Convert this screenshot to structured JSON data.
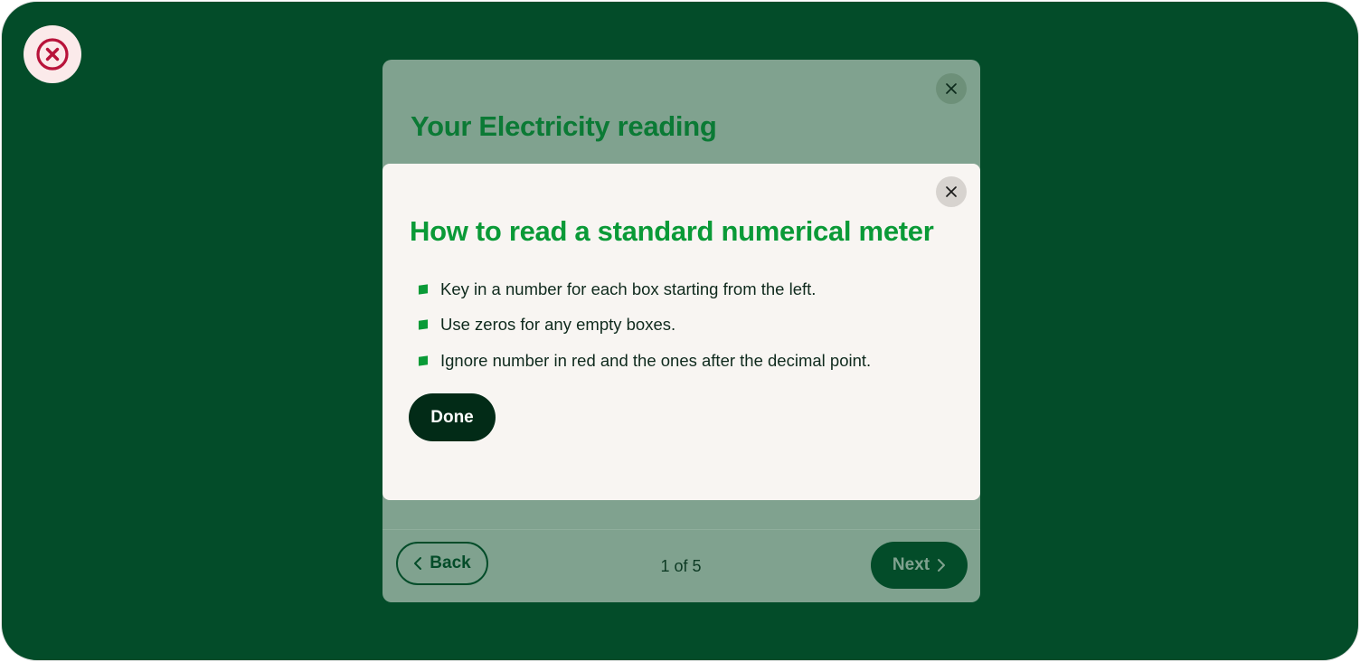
{
  "app": {
    "status_icon": "error-circle-x-icon",
    "colors": {
      "background": "#034c29",
      "accent_green": "#0a9a37",
      "error_red": "#b8133a",
      "dark_button": "#022b17"
    }
  },
  "reading_modal": {
    "title": "Your Electricity reading",
    "close_icon": "close-icon",
    "back_label": "Back",
    "page_indicator": "1 of 5",
    "next_label": "Next"
  },
  "help_modal": {
    "title": "How to read a standard numerical meter",
    "close_icon": "close-icon",
    "tips": [
      "Key in a number for each box starting from the left.",
      "Use zeros for any empty boxes.",
      "Ignore number in red and the ones after the decimal point."
    ],
    "done_label": "Done"
  }
}
